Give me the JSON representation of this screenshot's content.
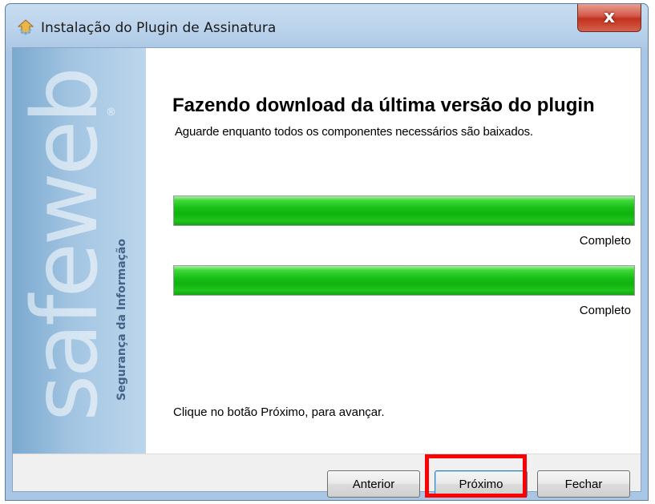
{
  "window": {
    "title": "Instalação do Plugin de Assinatura",
    "close_label": "x",
    "icon": "installer-icon"
  },
  "banner": {
    "brand": "safeweb",
    "tagline": "Segurança da Informação",
    "registered_mark": "®"
  },
  "main": {
    "heading": "Fazendo download da última versão do plugin",
    "subheading": "Aguarde enquanto todos os componentes necessários são baixados.",
    "progress": [
      {
        "value": 1.0,
        "status": "Completo"
      },
      {
        "value": 1.0,
        "status": "Completo"
      }
    ],
    "instruction": "Clique no botão Próximo, para avançar."
  },
  "footer": {
    "back_label": "Anterior",
    "next_label": "Próximo",
    "close_label": "Fechar"
  },
  "colors": {
    "progress_fill": "#19c016",
    "highlight": "#ff0000",
    "titlebar": "#bcd4ec"
  }
}
